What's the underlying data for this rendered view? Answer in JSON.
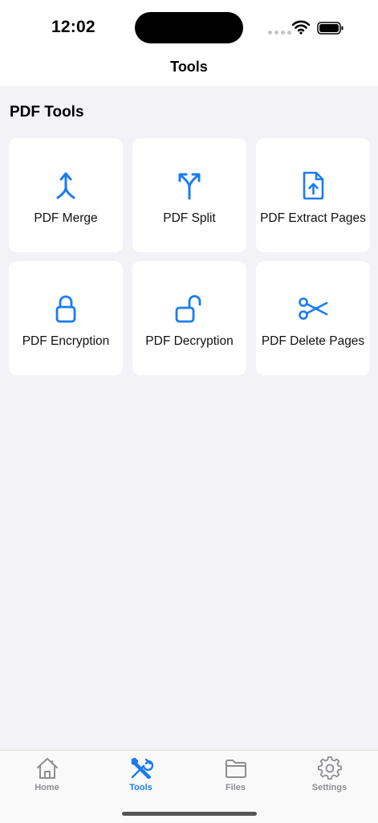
{
  "status_bar": {
    "time": "12:02"
  },
  "nav": {
    "title": "Tools"
  },
  "section": {
    "title": "PDF Tools"
  },
  "accent_color": "#1a7cf0",
  "tools": [
    {
      "label": "PDF Merge",
      "icon": "merge-arrows-icon"
    },
    {
      "label": "PDF Split",
      "icon": "split-arrows-icon"
    },
    {
      "label": "PDF Extract Pages",
      "icon": "document-upload-icon"
    },
    {
      "label": "PDF Encryption",
      "icon": "lock-icon"
    },
    {
      "label": "PDF Decryption",
      "icon": "unlock-icon"
    },
    {
      "label": "PDF Delete Pages",
      "icon": "scissors-icon"
    }
  ],
  "tabbar": {
    "items": [
      {
        "label": "Home",
        "icon": "house-icon",
        "active": false
      },
      {
        "label": "Tools",
        "icon": "wrench-screwdriver-icon",
        "active": true
      },
      {
        "label": "Files",
        "icon": "folder-icon",
        "active": false
      },
      {
        "label": "Settings",
        "icon": "gear-icon",
        "active": false
      }
    ]
  }
}
